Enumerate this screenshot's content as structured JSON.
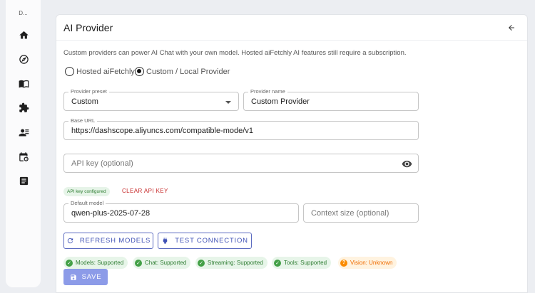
{
  "sidebar": {
    "label": "D...",
    "items": [
      {
        "icon": "home-icon"
      },
      {
        "icon": "compass-icon"
      },
      {
        "icon": "book-icon"
      },
      {
        "icon": "puzzle-icon"
      },
      {
        "icon": "contacts-icon"
      },
      {
        "icon": "calendar-clock-icon"
      },
      {
        "icon": "article-icon"
      }
    ]
  },
  "card": {
    "title": "AI Provider",
    "description": "Custom providers can power AI Chat with your own model. Hosted aiFetchly AI features still require a subscription.",
    "provider_options": [
      {
        "label": "Hosted aiFetchly",
        "selected": false
      },
      {
        "label": "Custom / Local Provider",
        "selected": true
      }
    ],
    "provider_preset": {
      "label": "Provider preset",
      "value": "Custom"
    },
    "provider_name": {
      "label": "Provider name",
      "value": "Custom Provider"
    },
    "base_url": {
      "label": "Base URL",
      "value": "https://dashscope.aliyuncs.com/compatible-mode/v1"
    },
    "api_key": {
      "placeholder": "API key (optional)"
    },
    "api_key_status": "API key configured",
    "clear_api_key": "CLEAR API KEY",
    "default_model": {
      "label": "Default model",
      "value": "qwen-plus-2025-07-28"
    },
    "context_size": {
      "placeholder": "Context size (optional)"
    },
    "refresh_models": "REFRESH MODELS",
    "test_connection": "TEST CONNECTION",
    "capabilities": [
      {
        "text": "Models: Supported",
        "status": "ok"
      },
      {
        "text": "Chat: Supported",
        "status": "ok"
      },
      {
        "text": "Streaming: Supported",
        "status": "ok"
      },
      {
        "text": "Tools: Supported",
        "status": "ok"
      },
      {
        "text": "Vision: Unknown",
        "status": "unknown"
      }
    ],
    "save": "SAVE"
  },
  "colors": {
    "accent": "#3f51b5",
    "save_bg": "#8c9be8",
    "ok": "#43a047",
    "warn": "#fb8c00",
    "danger": "#c62828"
  }
}
